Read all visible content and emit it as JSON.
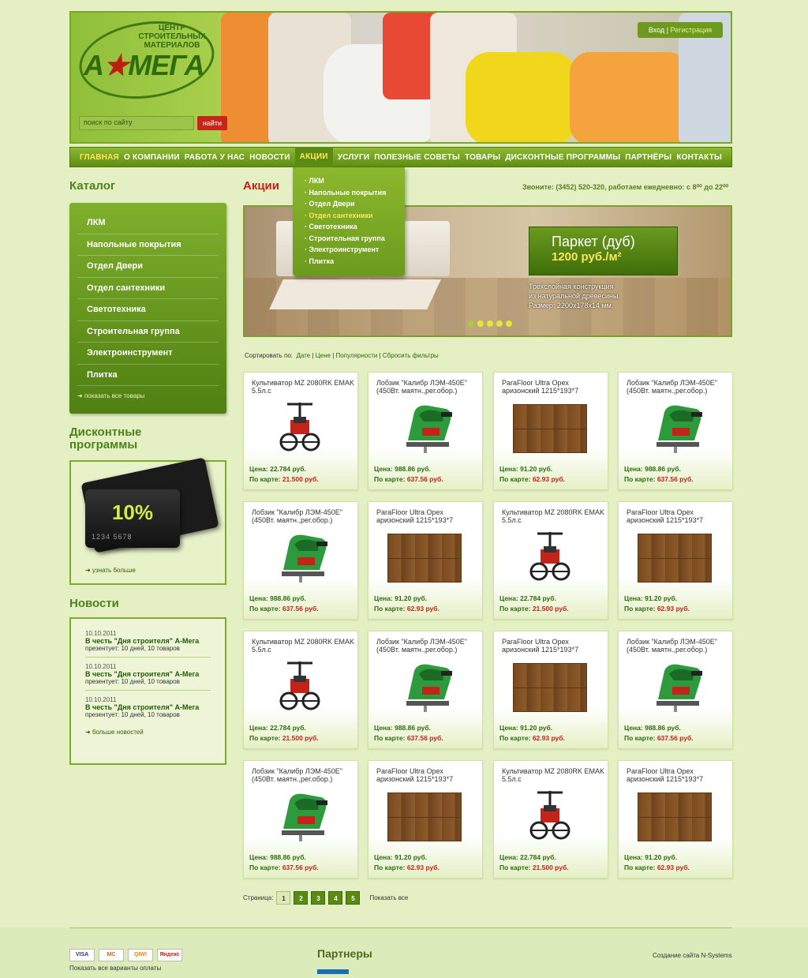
{
  "header": {
    "logo_subtitle": "ЦЕНТР СТРОИТЕЛЬНЫХ МАТЕРИАЛОВ",
    "logo_a": "А",
    "logo_star": "★",
    "logo_name": "МЕГА",
    "search_placeholder": "поиск по сайту",
    "search_button": "найти",
    "login": "Вход",
    "register": "Регистрация"
  },
  "nav": {
    "items": [
      "ГЛАВНАЯ",
      "О КОМПАНИИ",
      "РАБОТА У НАС",
      "НОВОСТИ",
      "АКЦИИ",
      "УСЛУГИ",
      "ПОЛЕЗНЫЕ СОВЕТЫ",
      "ТОВАРЫ",
      "ДИСКОНТНЫЕ ПРОГРАММЫ",
      "ПАРТНЁРЫ",
      "КОНТАКТЫ"
    ],
    "dropdown": [
      "ЛКМ",
      "Напольные покрытия",
      "Отдел Двери",
      "Отдел сантехники",
      "Светотехника",
      "Строительная группа",
      "Электроинструмент",
      "Плитка"
    ]
  },
  "sidebar": {
    "catalog_title": "Каталог",
    "catalog": [
      "ЛКМ",
      "Напольные покрытия",
      "Отдел Двери",
      "Отдел сантехники",
      "Светотехника",
      "Строительная группа",
      "Электроинструмент",
      "Плитка"
    ],
    "show_all": "показать все товары",
    "discount_title_1": "Дисконтные",
    "discount_title_2": "программы",
    "discount_card": "10%",
    "discount_card_number": "1234 5678",
    "discount_more": "узнать больше",
    "news_title": "Новости",
    "news": [
      {
        "date": "10.10.2011",
        "title": "В честь \"Дня строителя\" А-Мега",
        "text": "презентует: 10 дней, 10 товаров"
      },
      {
        "date": "10.10.2011",
        "title": "В честь \"Дня строителя\" А-Мега",
        "text": "презентует: 10 дней, 10 товаров"
      },
      {
        "date": "10.10.2011",
        "title": "В честь \"Дня строителя\" А-Мега",
        "text": "презентует: 10 дней, 10 товаров"
      }
    ],
    "news_more": "больше новостей"
  },
  "content": {
    "title": "Акции",
    "phone": "Звоните: (3452) 520-320, работаем ежедневно: с 8⁰⁰ до 22⁰⁰",
    "banner": {
      "name": "Паркет (дуб)",
      "price": "1200 руб./м²",
      "desc_1": "Трехслойная конструкция",
      "desc_2": "из натуральной древесины.",
      "desc_3": "Размер: 2200x178x14 мм."
    },
    "sort": {
      "label": "Сортировать по:",
      "date": "Дате",
      "price": "Цене",
      "popularity": "Популярности",
      "reset": "Сбросить фильтры",
      "sep": "|"
    },
    "price_label": "Цена:",
    "card_label": "По карте:",
    "products": [
      {
        "kind": "cult",
        "name": "Культиватор MZ 2080RK EMAK 5.5л.с",
        "price": "22.784 руб.",
        "card": "21.500 руб."
      },
      {
        "kind": "jig",
        "name": "Лобзик \"Калибр ЛЭМ-450Е\" (450Вт. маятн.,рег.обор.)",
        "price": "988.86 руб.",
        "card": "637.56 руб."
      },
      {
        "kind": "parquet",
        "name": "ParaFloor Ultra Орех аризонский 1215*193*7",
        "price": "91.20 руб.",
        "card": "62.93 руб."
      },
      {
        "kind": "jig",
        "name": "Лобзик \"Калибр ЛЭМ-450Е\" (450Вт. маятн.,рег.обор.)",
        "price": "988.86 руб.",
        "card": "637.56 руб."
      },
      {
        "kind": "jig",
        "name": "Лобзик \"Калибр ЛЭМ-450Е\" (450Вт. маятн.,рег.обор.)",
        "price": "988.86 руб.",
        "card": "637.56 руб."
      },
      {
        "kind": "parquet",
        "name": "ParaFloor Ultra Орех аризонский 1215*193*7",
        "price": "91.20 руб.",
        "card": "62.93 руб."
      },
      {
        "kind": "cult",
        "name": "Культиватор MZ 2080RK EMAK 5.5л.с",
        "price": "22.784 руб.",
        "card": "21.500 руб."
      },
      {
        "kind": "parquet",
        "name": "ParaFloor Ultra Орех аризонский 1215*193*7",
        "price": "91.20 руб.",
        "card": "62.93 руб."
      },
      {
        "kind": "cult",
        "name": "Культиватор MZ 2080RK EMAK 5.5л.с",
        "price": "22.784 руб.",
        "card": "21.500 руб."
      },
      {
        "kind": "jig",
        "name": "Лобзик \"Калибр ЛЭМ-450Е\" (450Вт. маятн.,рег.обор.)",
        "price": "988.86 руб.",
        "card": "637.56 руб."
      },
      {
        "kind": "parquet",
        "name": "ParaFloor Ultra Орех аризонский 1215*193*7",
        "price": "91.20 руб.",
        "card": "62.93 руб."
      },
      {
        "kind": "jig",
        "name": "Лобзик \"Калибр ЛЭМ-450Е\" (450Вт. маятн.,рег.обор.)",
        "price": "988.86 руб.",
        "card": "637.56 руб."
      },
      {
        "kind": "jig",
        "name": "Лобзик \"Калибр ЛЭМ-450Е\" (450Вт. маятн.,рег.обор.)",
        "price": "988.86 руб.",
        "card": "637.56 руб."
      },
      {
        "kind": "parquet",
        "name": "ParaFloor Ultra Орех аризонский 1215*193*7",
        "price": "91.20 руб.",
        "card": "62.93 руб."
      },
      {
        "kind": "cult",
        "name": "Культиватор MZ 2080RK EMAK 5.5л.с",
        "price": "22.784 руб.",
        "card": "21.500 руб."
      },
      {
        "kind": "parquet",
        "name": "ParaFloor Ultra Орех аризонский 1215*193*7",
        "price": "91.20 руб.",
        "card": "62.93 руб."
      }
    ],
    "pager": {
      "label": "Страница:",
      "pages": [
        "1",
        "2",
        "3",
        "4",
        "5"
      ],
      "show_all": "Показать все"
    }
  },
  "footer": {
    "pay": [
      "VISA",
      "MC",
      "QIWI",
      "Яндекс"
    ],
    "pay_all": "Показать все варианты оплаты",
    "partners": "Партнеры",
    "credits": "Создание сайта N-Systems"
  },
  "colors": {
    "brand_green": "#5e8d14",
    "accent_red": "#c4231a",
    "highlight_yellow": "#ffe55c"
  }
}
